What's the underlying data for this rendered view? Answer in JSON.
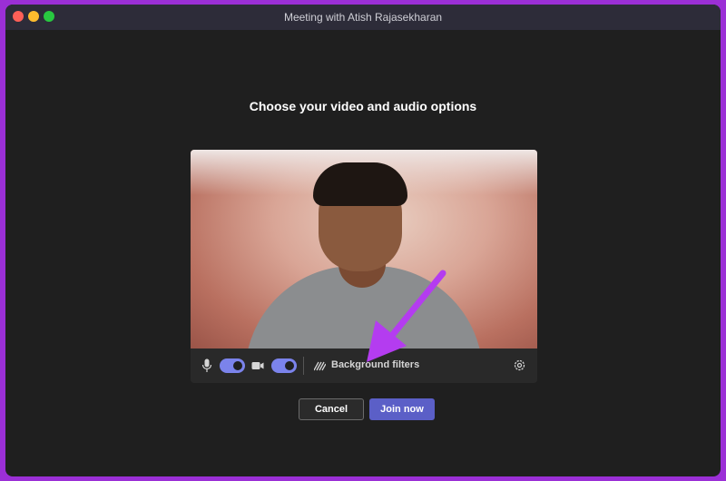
{
  "window": {
    "title": "Meeting with Atish Rajasekharan"
  },
  "main": {
    "heading": "Choose your video and audio options"
  },
  "controls": {
    "mic_on": true,
    "camera_on": true,
    "background_filters_label": "Background filters"
  },
  "actions": {
    "cancel_label": "Cancel",
    "join_label": "Join now"
  },
  "colors": {
    "accent": "#5b5fc7",
    "toggle": "#7b83eb",
    "annotation_arrow": "#b43cf0"
  }
}
